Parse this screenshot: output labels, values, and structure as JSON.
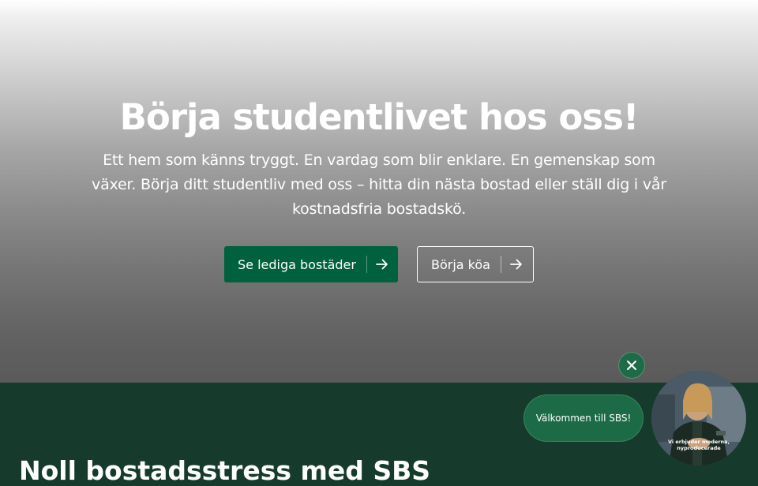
{
  "hero": {
    "title": "Börja studentlivet hos oss!",
    "subtitle": "Ett hem som känns tryggt. En vardag som blir enklare. En gemenskap som växer. Börja ditt studentliv med oss – hitta din nästa bostad eller ställ dig i vår kostnadsfria bostadskö.",
    "primary_button": {
      "label": "Se lediga bostäder",
      "icon": "arrow-right-icon"
    },
    "secondary_button": {
      "label": "Börja köa",
      "icon": "arrow-right-icon"
    }
  },
  "section": {
    "heading": "Noll bostadsstress med SBS"
  },
  "chat_widget": {
    "close_icon": "close-icon",
    "welcome_text": "Välkommen till SBS!",
    "video_caption": "Vi erbjuder moderna, nyproducerade"
  },
  "colors": {
    "primary_green": "#00613e",
    "dark_green": "#163a2c",
    "bubble_green": "#1c6b46"
  }
}
